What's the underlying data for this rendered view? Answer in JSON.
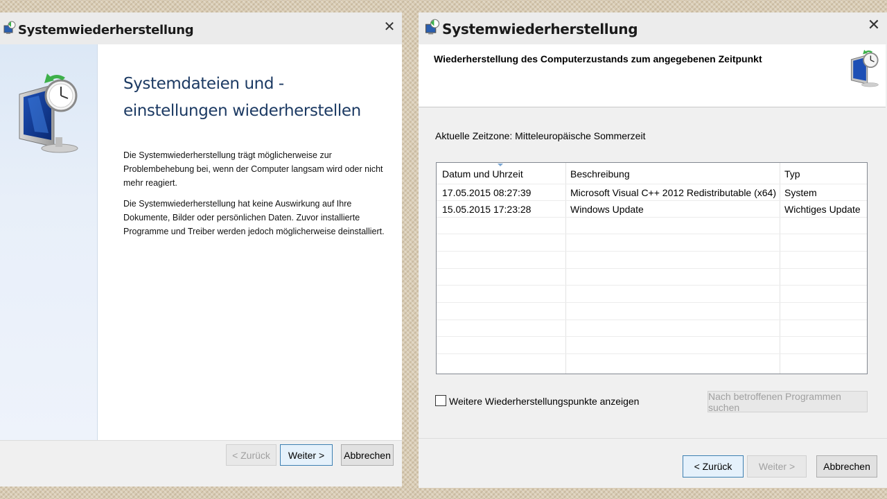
{
  "left_window": {
    "title": "Systemwiederherstellung",
    "close_label": "✕",
    "heading": "Systemdateien und -einstellungen wiederherstellen",
    "paragraph1": "Die Systemwiederherstellung trägt möglicherweise zur Problembehebung bei, wenn der Computer langsam wird oder nicht mehr reagiert.",
    "paragraph2": "Die Systemwiederherstellung hat keine Auswirkung auf Ihre Dokumente, Bilder oder persönlichen Daten. Zuvor installierte Programme und Treiber werden jedoch möglicherweise deinstalliert.",
    "buttons": {
      "back": "< Zurück",
      "next": "Weiter >",
      "cancel": "Abbrechen"
    },
    "icon": "system-restore-icon"
  },
  "right_window": {
    "title": "Systemwiederherstellung",
    "close_label": "✕",
    "header_title": "Wiederherstellung des Computerzustands zum angegebenen Zeitpunkt",
    "timezone": "Aktuelle Zeitzone: Mitteleuropäische Sommerzeit",
    "table": {
      "columns": [
        "Datum und Uhrzeit",
        "Beschreibung",
        "Typ"
      ],
      "rows": [
        [
          "17.05.2015 08:27:39",
          "Microsoft Visual C++ 2012 Redistributable (x64) ...",
          "System"
        ],
        [
          "15.05.2015 17:23:28",
          "Windows Update",
          "Wichtiges Update"
        ]
      ]
    },
    "show_more_label": "Weitere Wiederherstellungspunkte anzeigen",
    "show_more_checked": false,
    "scan_button": "Nach betroffenen Programmen suchen",
    "buttons": {
      "back": "< Zurück",
      "next": "Weiter >",
      "cancel": "Abbrechen"
    }
  },
  "colors": {
    "accent_blue": "#1c3a63",
    "primary_button_border": "#3c7fb1",
    "disabled_text": "#a0a0a0"
  }
}
